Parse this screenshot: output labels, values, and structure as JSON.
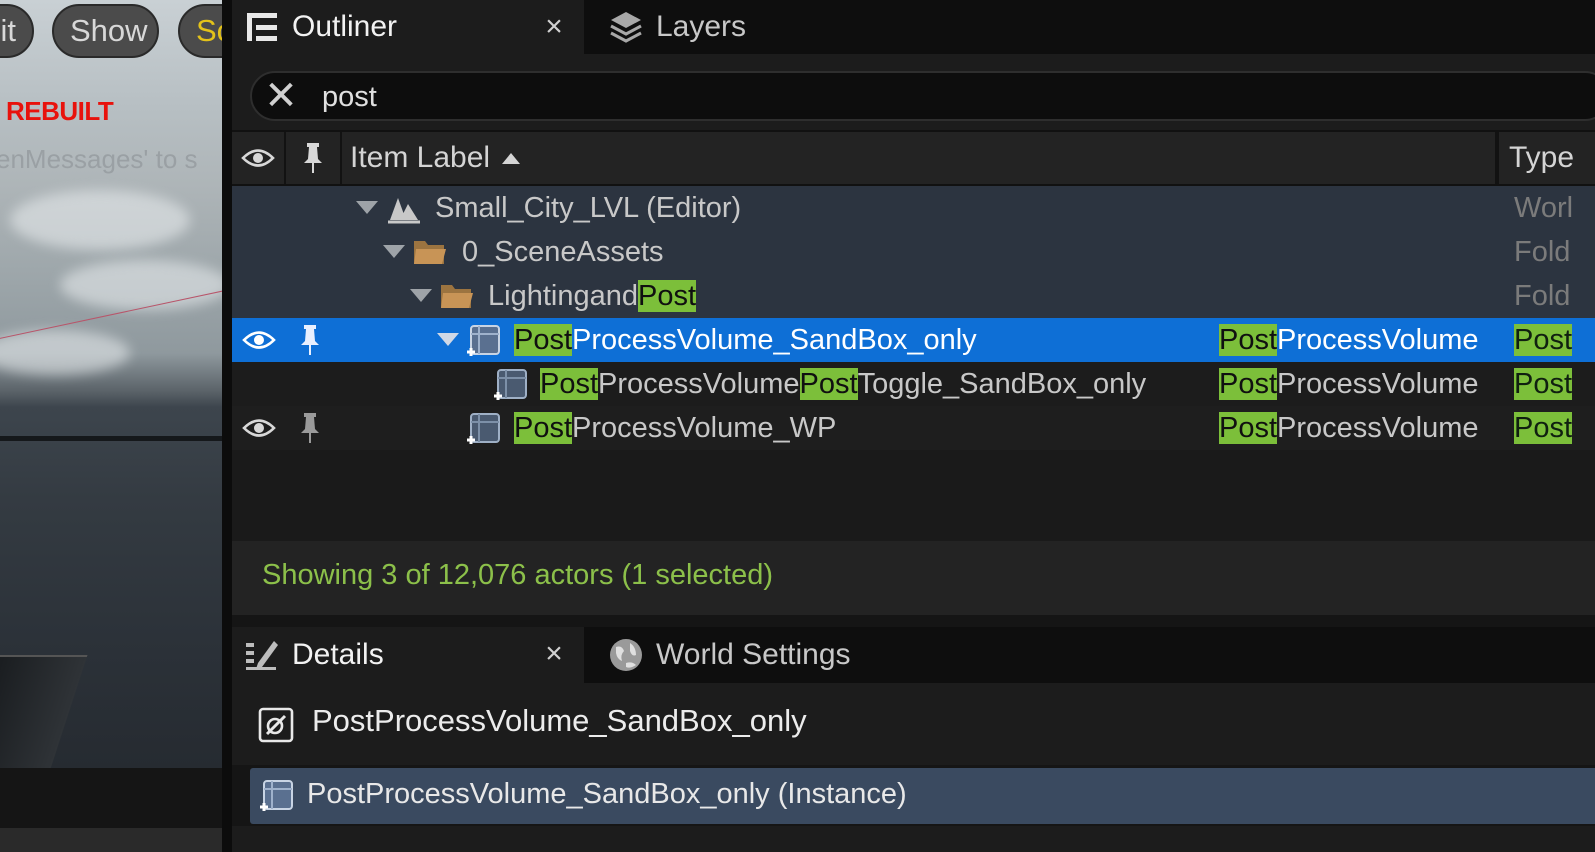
{
  "viewport": {
    "buttons": [
      "it",
      "Show",
      "Sc"
    ],
    "warning": "REBUILT",
    "message": "enMessages' to s"
  },
  "outliner_tabs": {
    "outliner_label": "Outliner",
    "close_glyph": "×",
    "layers_label": "Layers"
  },
  "search": {
    "value": "post",
    "clear_glyph": "✕"
  },
  "columns": {
    "item_label": "Item Label",
    "type": "Type"
  },
  "rows": [
    {
      "label": "Small_City_LVL (Editor)",
      "type": "Worl"
    },
    {
      "label": "0_SceneAssets",
      "type": "Fold"
    },
    {
      "label_pre": "Lightingand",
      "label_hl": "Post",
      "type": "Fold"
    },
    {
      "label_hl": "Post",
      "label_rest": "ProcessVolume_SandBox_only",
      "type_hl": "Post",
      "type_rest": "ProcessVolume",
      "type2": "Post"
    },
    {
      "label_hl": "Post",
      "label_mid": "ProcessVolume",
      "label_hl2": "Post",
      "label_rest": "Toggle_SandBox_only",
      "type_hl": "Post",
      "type_rest": "ProcessVolume",
      "type2": "Post"
    },
    {
      "label_hl": "Post",
      "label_rest": "ProcessVolume_WP",
      "type_hl": "Post",
      "type_rest": "ProcessVolume",
      "type2": "Post"
    }
  ],
  "status": "Showing 3 of 12,076 actors (1 selected)",
  "details_tabs": {
    "details_label": "Details",
    "close_glyph": "×",
    "world_settings_label": "World Settings"
  },
  "details": {
    "title": "PostProcessVolume_SandBox_only",
    "instance": "PostProcessVolume_SandBox_only (Instance)"
  },
  "colors": {
    "selection": "#0e6fd6",
    "highlight": "#7cbf3a",
    "status_text": "#8cc04a",
    "warning": "#e8120c"
  },
  "icons": [
    "outliner-icon",
    "layers-icon",
    "clear-search-icon",
    "eye-icon",
    "pin-icon",
    "world-icon",
    "folder-icon",
    "volume-actor-icon",
    "details-icon",
    "world-settings-icon",
    "actor-class-icon"
  ]
}
